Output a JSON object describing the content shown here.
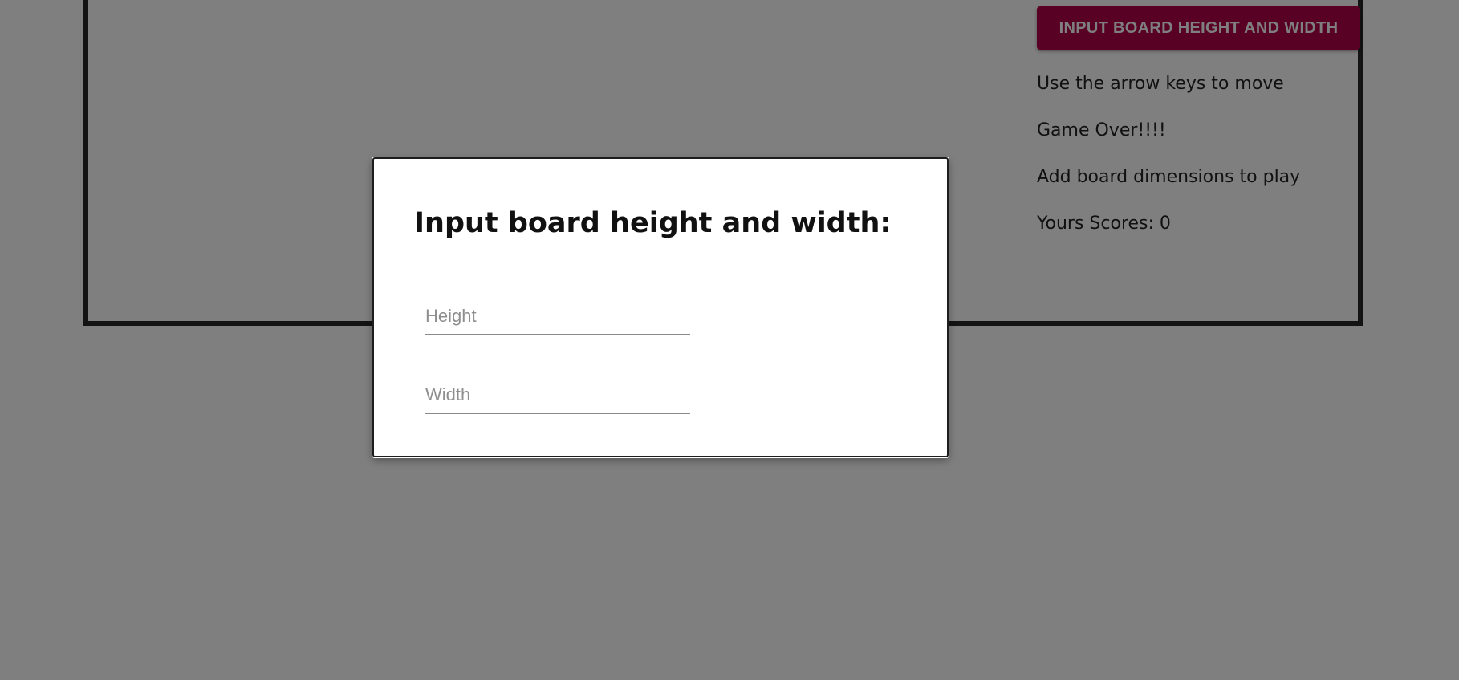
{
  "game": {
    "action_button_label": "INPUT BOARD HEIGHT AND WIDTH",
    "instructions": "Use the arrow keys to move",
    "status": "Game Over!!!!",
    "hint": "Add board dimensions to play",
    "score_text": "Yours Scores: 0"
  },
  "dialog": {
    "title": "Input board height and width:",
    "height_placeholder": "Height",
    "width_placeholder": "Width",
    "height_value": "",
    "width_value": ""
  },
  "colors": {
    "button_accent": "#b3004a",
    "overlay": "rgba(0,0,0,0.5)",
    "board_border": "#262626"
  }
}
